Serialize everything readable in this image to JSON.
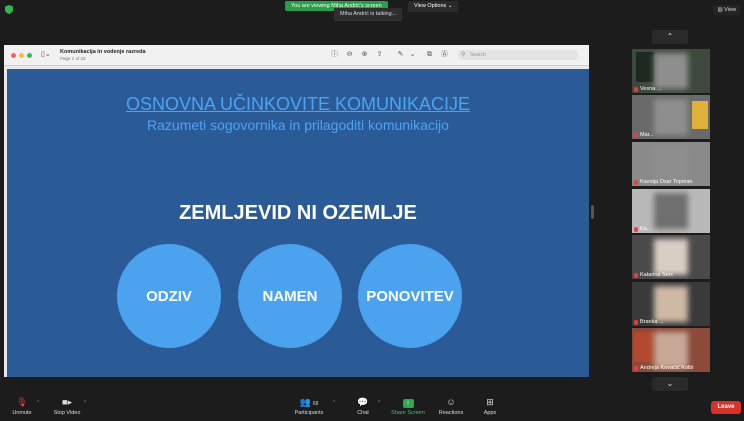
{
  "top_bar": {
    "viewing_badge": "You are viewing Miha Andrić's screen",
    "talking": "Miha Andrić is talking...",
    "view_options": "View Options ⌄",
    "view_button": "▥ View"
  },
  "pdf_window": {
    "title": "Komunikacija in vodenje razreda",
    "page": "Page 1 of 33",
    "search_placeholder": "Search"
  },
  "slide": {
    "title": "OSNOVNA UČINKOVITE KOMUNIKACIJE",
    "subtitle": "Razumeti sogovornika in prilagoditi komunikacijo",
    "heading": "ZEMLJEVID NI OZEMLJE",
    "circles": [
      "ODZIV",
      "NAMEN",
      "PONOVITEV"
    ]
  },
  "gallery": {
    "participants": [
      {
        "name": "Vesna ..."
      },
      {
        "name": "Mar..."
      },
      {
        "name": "Ksenija Osar Topman"
      },
      {
        "name": "Ka..."
      },
      {
        "name": "Katarina Serc"
      },
      {
        "name": "Branka ..."
      },
      {
        "name": "Andreja Kovačič Kolbl"
      }
    ]
  },
  "bottom_bar": {
    "unmute": "Unmute",
    "stop_video": "Stop Video",
    "participants": "Participants",
    "participant_count": "68",
    "chat": "Chat",
    "share_screen": "Share Screen",
    "reactions": "Reactions",
    "apps": "Apps",
    "leave": "Leave"
  },
  "colors": {
    "slide_bg": "#2b5b97",
    "slide_accent": "#4aa4f2",
    "share_green": "#2ea84f",
    "leave_red": "#d9322b"
  }
}
